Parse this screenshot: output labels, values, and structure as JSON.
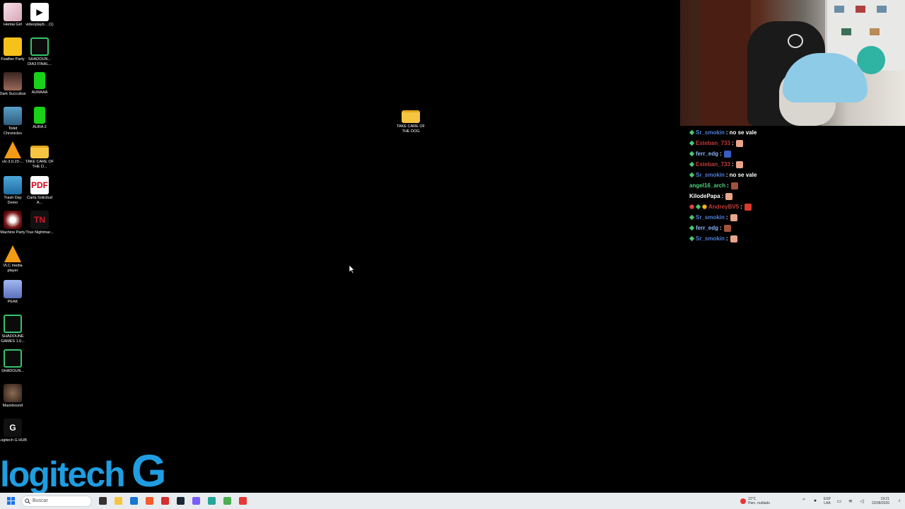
{
  "desktop_icons": [
    {
      "label": "Hentai Girl",
      "glyph": ""
    },
    {
      "label": "videoplayb... (1)",
      "glyph": "▶"
    },
    {
      "label": "Feather Party",
      "glyph": ""
    },
    {
      "label": "SHADOUN... DIA3 FINAL...",
      "glyph": ""
    },
    {
      "label": "Dark Succubus",
      "glyph": ""
    },
    {
      "label": "AURAAA",
      "glyph": ""
    },
    {
      "label": "Toilet Chronicles",
      "glyph": ""
    },
    {
      "label": "AURA 2",
      "glyph": ""
    },
    {
      "label": "vlc-3.0.23-...",
      "glyph": ""
    },
    {
      "label": "TAKE CARE OF THE D...",
      "glyph": ""
    },
    {
      "label": "Trash Day Demo",
      "glyph": ""
    },
    {
      "label": "Carta Solicitud A...",
      "glyph": "PDF"
    },
    {
      "label": "Machine Party",
      "glyph": ""
    },
    {
      "label": "True Nightmar...",
      "glyph": "TN"
    },
    {
      "label": "VLC media player",
      "glyph": ""
    },
    {
      "label": "PEAK",
      "glyph": ""
    },
    {
      "label": "SHADOUNE GAMES 1.0...",
      "glyph": ""
    },
    {
      "label": "SHADOUN...",
      "glyph": ""
    },
    {
      "label": "Mazebound",
      "glyph": ""
    },
    {
      "label": "Logitech G HUB",
      "glyph": "G"
    }
  ],
  "center_folder": {
    "label": "TAKE CARE OF THE DOG"
  },
  "chat": [
    {
      "user": "Sr_smokin",
      "color": "#4f7fd9",
      "badges": [
        "diamond"
      ],
      "msg": "no se vale",
      "emote": ""
    },
    {
      "user": "Esteban_733",
      "color": "#c23a3a",
      "badges": [
        "diamond"
      ],
      "msg": "",
      "emote": "#e9a58a"
    },
    {
      "user": "ferr_edg",
      "color": "#8ab4f8",
      "badges": [
        "diamond"
      ],
      "msg": "",
      "emote": "#3b5cc4"
    },
    {
      "user": "Esteban_733",
      "color": "#c23a3a",
      "badges": [
        "diamond"
      ],
      "msg": "",
      "emote": "#e9a58a"
    },
    {
      "user": "Sr_smokin",
      "color": "#4f7fd9",
      "badges": [
        "diamond"
      ],
      "msg": "no se vale",
      "emote": ""
    },
    {
      "user": "angel16_arch",
      "color": "#4cd17a",
      "badges": [],
      "msg": "",
      "emote": "#a0523a"
    },
    {
      "user": "KilodePapa",
      "color": "#ffffff",
      "badges": [],
      "msg": "",
      "emote": "#e9a58a"
    },
    {
      "user": "AndreyBV5",
      "color": "#c23a3a",
      "badges": [
        "red",
        "diamond",
        "yellow"
      ],
      "msg": "",
      "emote": "#d63b2e"
    },
    {
      "user": "Sr_smokin",
      "color": "#4f7fd9",
      "badges": [
        "diamond"
      ],
      "msg": "",
      "emote": "#e9a58a"
    },
    {
      "user": "ferr_edg",
      "color": "#8ab4f8",
      "badges": [
        "diamond"
      ],
      "msg": "",
      "emote": "#a0523a"
    },
    {
      "user": "Sr_smokin",
      "color": "#4f7fd9",
      "badges": [
        "diamond"
      ],
      "msg": "",
      "emote": "#e9a58a"
    }
  ],
  "watermark": {
    "word": "logitech",
    "letter": "G"
  },
  "taskbar": {
    "search_placeholder": "Buscar",
    "apps": [
      {
        "name": "task-view",
        "color": "#333333"
      },
      {
        "name": "file-explorer",
        "color": "#f5c542"
      },
      {
        "name": "store",
        "color": "#1976d2"
      },
      {
        "name": "brave",
        "color": "#f25c2a"
      },
      {
        "name": "app-red",
        "color": "#d32f2f"
      },
      {
        "name": "steam",
        "color": "#1b2838"
      },
      {
        "name": "messenger",
        "color": "#7b5cff"
      },
      {
        "name": "app-teal",
        "color": "#26a69a"
      },
      {
        "name": "chrome",
        "color": "#4caf50"
      },
      {
        "name": "app-capture",
        "color": "#e53935"
      }
    ],
    "weather_temp": "22°C",
    "weather_desc": "Parc. nublado",
    "lang_top": "ESP",
    "lang_bottom": "LAA",
    "time": "19:21",
    "date": "22/08/2026"
  }
}
